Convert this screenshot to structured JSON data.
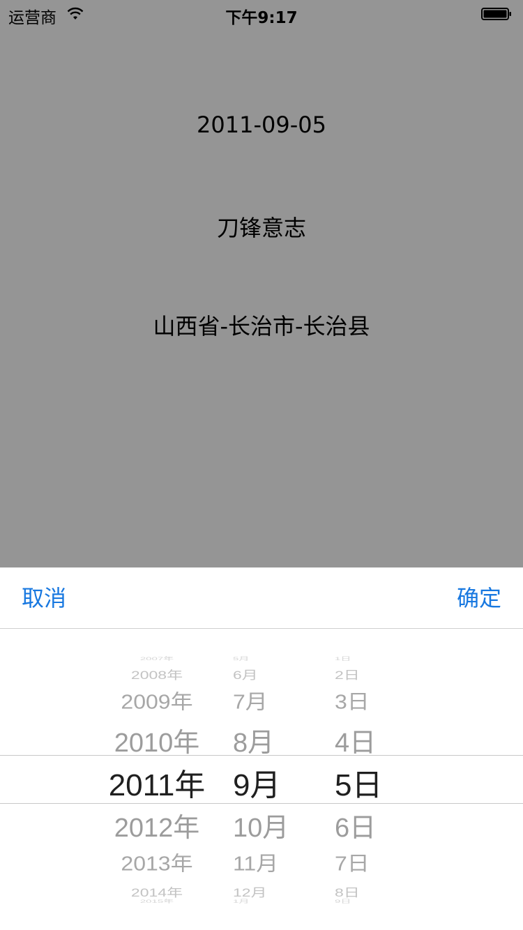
{
  "status_bar": {
    "carrier": "运营商",
    "time": "下午9:17",
    "wifi_icon": "wifi-icon",
    "battery_icon": "battery-icon"
  },
  "content": {
    "date_text": "2011-09-05",
    "name_text": "刀锋意志",
    "region_text": "山西省-长治市-长治县"
  },
  "toolbar": {
    "cancel_label": "取消",
    "confirm_label": "确定",
    "accent_color": "#1878e0"
  },
  "picker": {
    "years": [
      "2007年",
      "2008年",
      "2009年",
      "2010年",
      "2011年",
      "2012年",
      "2013年",
      "2014年",
      "2015年"
    ],
    "months": [
      "5月",
      "6月",
      "7月",
      "8月",
      "9月",
      "10月",
      "11月",
      "12月",
      "1月"
    ],
    "days": [
      "1日",
      "2日",
      "3日",
      "4日",
      "5日",
      "6日",
      "7日",
      "8日",
      "9日"
    ],
    "selected": {
      "year": "2011年",
      "month": "9月",
      "day": "5日"
    }
  }
}
